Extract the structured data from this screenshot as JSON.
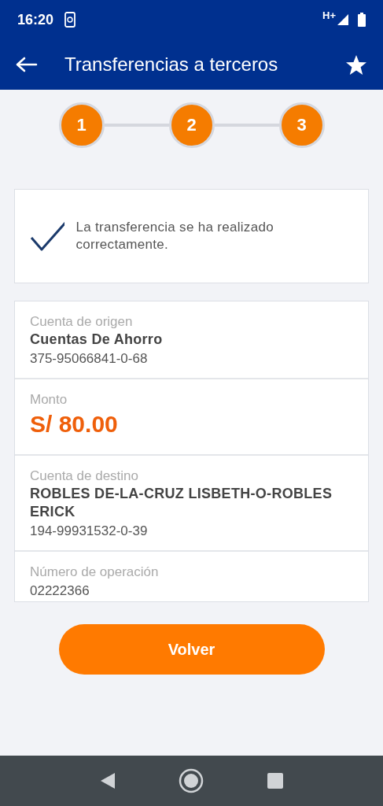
{
  "status_bar": {
    "time": "16:20",
    "network": "H+"
  },
  "header": {
    "title": "Transferencias a terceros"
  },
  "steps": [
    {
      "label": "1"
    },
    {
      "label": "2"
    },
    {
      "label": "3"
    }
  ],
  "success": {
    "message": "La transferencia se ha realizado correctamente."
  },
  "details": [
    {
      "label": "Cuenta de origen",
      "lines": [
        {
          "kind": "title",
          "text": "Cuentas De Ahorro"
        },
        {
          "kind": "number",
          "text": "375-95066841-0-68"
        }
      ]
    },
    {
      "label": "Monto",
      "lines": [
        {
          "kind": "amount",
          "text": "S/ 80.00"
        }
      ]
    },
    {
      "label": "Cuenta de destino",
      "lines": [
        {
          "kind": "title",
          "text": "ROBLES DE-LA-CRUZ LISBETH-O-ROBLES ERICK"
        },
        {
          "kind": "number",
          "text": "194-99931532-0-39"
        }
      ]
    },
    {
      "label": "Número de operación",
      "lines": [
        {
          "kind": "number",
          "text": "02222366"
        }
      ]
    }
  ],
  "button": {
    "label": "Volver"
  }
}
